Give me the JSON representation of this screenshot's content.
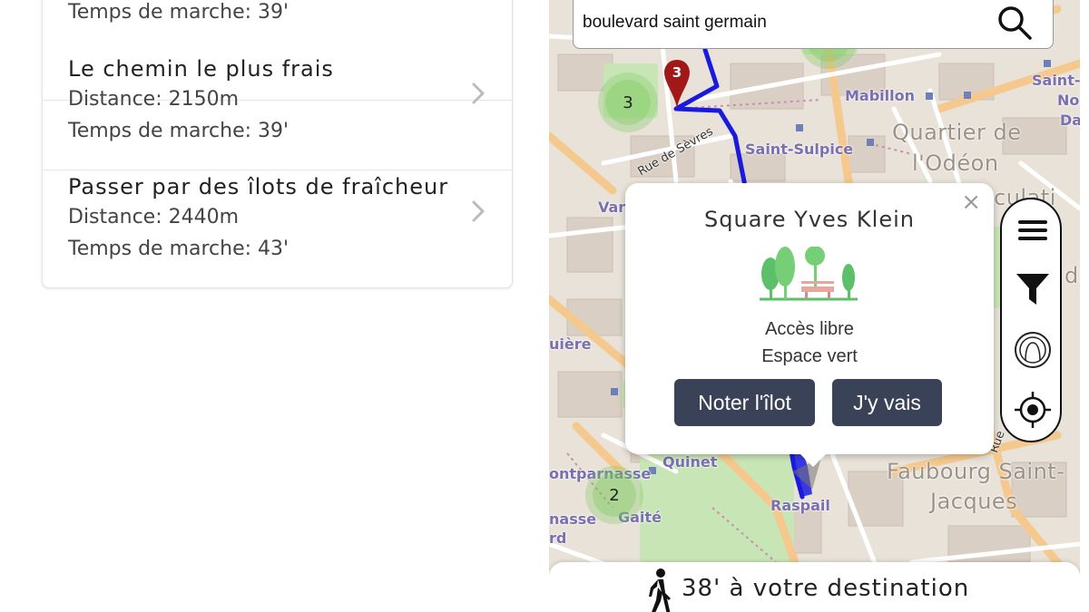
{
  "routes": {
    "items": [
      {
        "title": "",
        "distance": "",
        "time": "Temps de marche: 39'"
      },
      {
        "title": "Le chemin le plus frais",
        "distance": "Distance: 2150m",
        "time": "Temps de marche: 39'"
      },
      {
        "title": "Passer par des îlots de fraîcheur",
        "distance": "Distance: 2440m",
        "time": "Temps de marche: 43'"
      }
    ]
  },
  "search": {
    "value": "boulevard saint germain",
    "icon": "search-icon"
  },
  "map": {
    "labels": {
      "mabillon": "Mabillon",
      "saint_sulpice": "Saint-Sulpice",
      "quartier": "Quartier de",
      "odeon": "l'Odéon",
      "rue_sevres": "Rue de Sèvres",
      "quinet": "Quinet",
      "raspail": "Raspail",
      "faubourg": "Faubourg Saint-",
      "jacques": "Jacques",
      "montparnasse": "ontparnasse",
      "gaite": "Gaité",
      "nasse": "nasse",
      "rd": "rd",
      "uiere": "uière",
      "var": "Var",
      "saint_n": "Saint-",
      "no": "No",
      "da": "Da",
      "culati": "culati",
      "dis": "dis",
      "rue_short": "Rue"
    },
    "clusters": {
      "c3": "3",
      "c2": "2"
    },
    "marker": "3",
    "route_color": "#1a1adf",
    "park_color": "#c8e6b5",
    "cluster_color": "#78c85a"
  },
  "popup": {
    "title": "Square Yves Klein",
    "close": "×",
    "access": "Accès libre",
    "type": "Espace vert",
    "rate_button": "Noter l'îlot",
    "go_button": "J'y vais",
    "button_color": "#3a4258"
  },
  "toolbar": {
    "menu": "menu-icon",
    "filter": "filter-icon",
    "profile": "profile-icon",
    "locate": "locate-icon"
  },
  "bottom": {
    "text": "38' à votre destination"
  }
}
